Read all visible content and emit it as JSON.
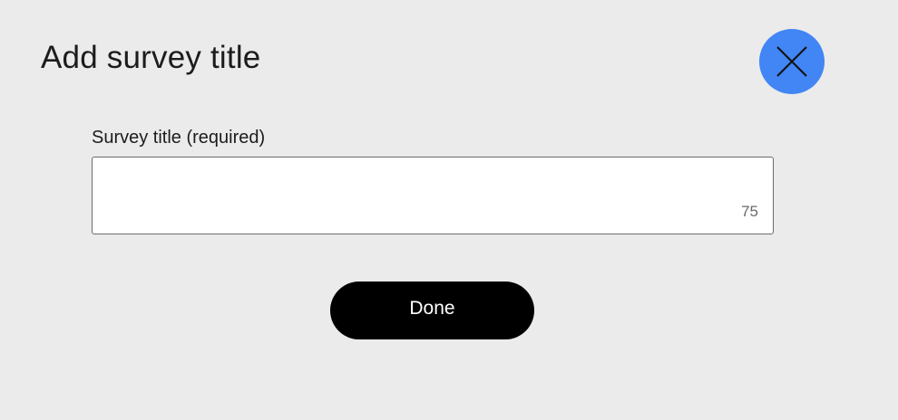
{
  "dialog": {
    "title": "Add survey title",
    "close_icon": "close-icon"
  },
  "field": {
    "label": "Survey title (required)",
    "value": "",
    "char_count": "75"
  },
  "actions": {
    "done_label": "Done"
  },
  "colors": {
    "background": "#ebebeb",
    "close_button": "#4285f4",
    "done_button": "#000000"
  }
}
